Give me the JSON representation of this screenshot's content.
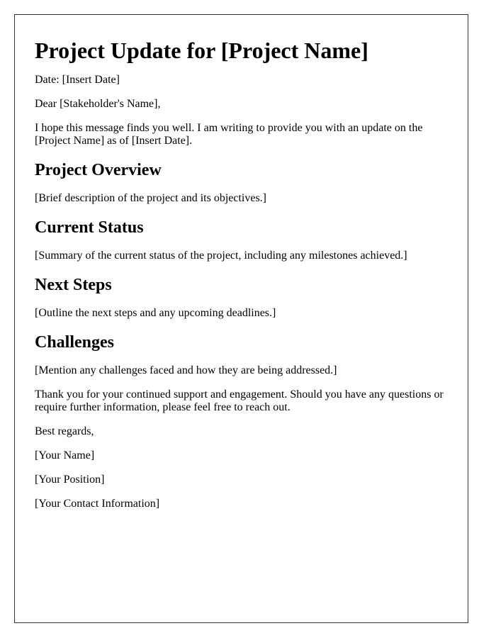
{
  "title": "Project Update for [Project Name]",
  "date_line": "Date: [Insert Date]",
  "salutation": "Dear [Stakeholder's Name],",
  "intro": "I hope this message finds you well. I am writing to provide you with an update on the [Project Name] as of [Insert Date].",
  "sections": [
    {
      "heading": "Project Overview",
      "body": "[Brief description of the project and its objectives.]"
    },
    {
      "heading": "Current Status",
      "body": "[Summary of the current status of the project, including any milestones achieved.]"
    },
    {
      "heading": "Next Steps",
      "body": "[Outline the next steps and any upcoming deadlines.]"
    },
    {
      "heading": "Challenges",
      "body": "[Mention any challenges faced and how they are being addressed.]"
    }
  ],
  "closing_paragraph": "Thank you for your continued support and engagement. Should you have any questions or require further information, please feel free to reach out.",
  "sign_off": "Best regards,",
  "signature": {
    "name": "[Your Name]",
    "position": "[Your Position]",
    "contact": "[Your Contact Information]"
  }
}
